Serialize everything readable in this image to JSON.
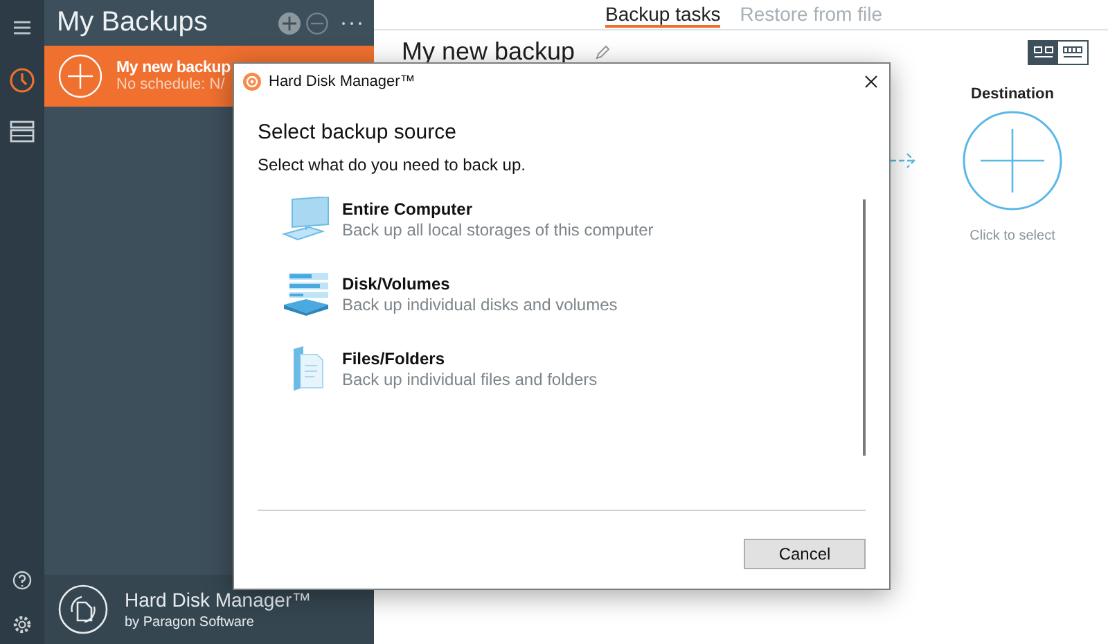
{
  "rail": {
    "items": [
      {
        "kind": "tasks",
        "selected": true
      },
      {
        "kind": "drives",
        "selected": false
      }
    ]
  },
  "sidebar": {
    "title": "My Backups",
    "backups": [
      {
        "name": "My new backup",
        "schedule": "No schedule: N/",
        "selected": true
      }
    ],
    "footer": {
      "product": "Hard Disk Manager™",
      "vendor": "by Paragon Software"
    }
  },
  "tabs": [
    {
      "label": "Backup tasks",
      "selected": true
    },
    {
      "label": "Restore from file",
      "selected": false
    }
  ],
  "view_modes": [
    {
      "kind": "tiles",
      "selected": true
    },
    {
      "kind": "list",
      "selected": false
    }
  ],
  "task": {
    "title": "My new backup",
    "destination": {
      "label": "Destination",
      "hint": "Click to select"
    }
  },
  "dialog": {
    "title": "Hard Disk Manager™",
    "heading": "Select backup source",
    "prompt": "Select what do you need to back up.",
    "options": [
      {
        "kind": "computer",
        "name": "Entire Computer",
        "description": "Back up all local storages of this computer"
      },
      {
        "kind": "disks",
        "name": "Disk/Volumes",
        "description": "Back up individual disks and volumes"
      },
      {
        "kind": "files",
        "name": "Files/Folders",
        "description": "Back up individual files and folders"
      }
    ],
    "buttons": [
      "Cancel"
    ]
  }
}
